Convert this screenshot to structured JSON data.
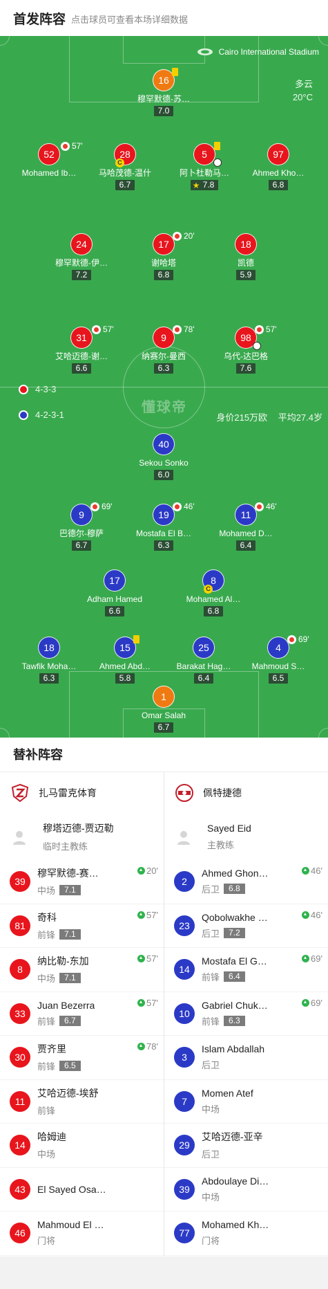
{
  "header": {
    "title": "首发阵容",
    "subtitle": "点击球员可查看本场详细数据"
  },
  "pitch": {
    "stadium": "Cairo International Stadium",
    "weather_desc": "多云",
    "weather_temp": "20°C",
    "watermark": "懂球帝",
    "home_formation": "4-3-3",
    "away_formation": "4-2-3-1",
    "value": "身价215万欧",
    "avg_age": "平均27.4岁"
  },
  "home_lineup": [
    {
      "num": "16",
      "name": "穆罕默德-苏…",
      "rating": "7.0",
      "color": "orange"
    },
    {
      "num": "52",
      "name": "Mohamed Ib…",
      "rating": "",
      "color": "red",
      "sub": "57'"
    },
    {
      "num": "28",
      "name": "马哈茂德-温什",
      "rating": "6.7",
      "color": "red"
    },
    {
      "num": "5",
      "name": "阿卜杜勒马…",
      "rating": "7.8",
      "color": "red"
    },
    {
      "num": "97",
      "name": "Ahmed Kho…",
      "rating": "6.8",
      "color": "red"
    },
    {
      "num": "24",
      "name": "穆罕默德-伊…",
      "rating": "7.2",
      "color": "red"
    },
    {
      "num": "17",
      "name": "谢哈塔",
      "rating": "6.8",
      "color": "red",
      "sub": "20'"
    },
    {
      "num": "18",
      "name": "凯德",
      "rating": "5.9",
      "color": "red"
    },
    {
      "num": "31",
      "name": "艾哈迈德-谢…",
      "rating": "6.6",
      "color": "red",
      "sub": "57'"
    },
    {
      "num": "9",
      "name": "纳赛尔-曼西",
      "rating": "6.3",
      "color": "red",
      "sub": "78'"
    },
    {
      "num": "98",
      "name": "乌代-达巴格",
      "rating": "7.6",
      "color": "red",
      "sub": "57'"
    }
  ],
  "away_lineup": [
    {
      "num": "40",
      "name": "Sekou Sonko",
      "rating": "6.0",
      "color": "blue"
    },
    {
      "num": "9",
      "name": "巴德尔-穆萨",
      "rating": "6.7",
      "color": "blue",
      "sub": "69'"
    },
    {
      "num": "19",
      "name": "Mostafa El B…",
      "rating": "6.3",
      "color": "blue",
      "sub": "46'"
    },
    {
      "num": "11",
      "name": "Mohamed D…",
      "rating": "6.4",
      "color": "blue",
      "sub": "46'"
    },
    {
      "num": "17",
      "name": "Adham Hamed",
      "rating": "6.6",
      "color": "blue"
    },
    {
      "num": "8",
      "name": "Mohamed Al…",
      "rating": "6.8",
      "color": "blue"
    },
    {
      "num": "18",
      "name": "Tawfik Moha…",
      "rating": "6.3",
      "color": "blue"
    },
    {
      "num": "15",
      "name": "Ahmed Abd…",
      "rating": "5.8",
      "color": "blue"
    },
    {
      "num": "25",
      "name": "Barakat Hag…",
      "rating": "6.4",
      "color": "blue"
    },
    {
      "num": "4",
      "name": "Mahmoud S…",
      "rating": "6.5",
      "color": "blue",
      "sub": "69'"
    },
    {
      "num": "1",
      "name": "Omar Salah",
      "rating": "6.7",
      "color": "orange"
    }
  ],
  "bench": {
    "title": "替补阵容",
    "home": {
      "team": "扎马雷克体育",
      "coach": "穆塔迈德-贾迈勒",
      "coach_role": "临时主教练",
      "subs": [
        {
          "num": "39",
          "name": "穆罕默德-赛…",
          "pos": "中场",
          "rating": "7.1",
          "in": "20'"
        },
        {
          "num": "81",
          "name": "奇科",
          "pos": "前锋",
          "rating": "7.1",
          "in": "57'"
        },
        {
          "num": "8",
          "name": "纳比勒-东加",
          "pos": "中场",
          "rating": "7.1",
          "in": "57'"
        },
        {
          "num": "33",
          "name": "Juan Bezerra",
          "pos": "前锋",
          "rating": "6.7",
          "in": "57'"
        },
        {
          "num": "30",
          "name": "贾齐里",
          "pos": "前锋",
          "rating": "6.5",
          "in": "78'"
        },
        {
          "num": "11",
          "name": "艾哈迈德-埃舒",
          "pos": "前锋",
          "rating": "",
          "in": ""
        },
        {
          "num": "14",
          "name": "哈姆迪",
          "pos": "中场",
          "rating": "",
          "in": ""
        },
        {
          "num": "43",
          "name": "El Sayed Osa…",
          "pos": "",
          "rating": "",
          "in": ""
        },
        {
          "num": "46",
          "name": "Mahmoud El …",
          "pos": "门将",
          "rating": "",
          "in": ""
        }
      ]
    },
    "away": {
      "team": "佩特捷德",
      "coach": "Sayed Eid",
      "coach_role": "主教练",
      "subs": [
        {
          "num": "2",
          "name": "Ahmed Ghon…",
          "pos": "后卫",
          "rating": "6.8",
          "in": "46'"
        },
        {
          "num": "23",
          "name": "Qobolwakhe …",
          "pos": "后卫",
          "rating": "7.2",
          "in": "46'"
        },
        {
          "num": "14",
          "name": "Mostafa El G…",
          "pos": "前锋",
          "rating": "6.4",
          "in": "69'"
        },
        {
          "num": "10",
          "name": "Gabriel Chuk…",
          "pos": "前锋",
          "rating": "6.3",
          "in": "69'"
        },
        {
          "num": "3",
          "name": "Islam Abdallah",
          "pos": "后卫",
          "rating": "",
          "in": ""
        },
        {
          "num": "7",
          "name": "Momen Atef",
          "pos": "中场",
          "rating": "",
          "in": ""
        },
        {
          "num": "29",
          "name": "艾哈迈德-亚辛",
          "pos": "后卫",
          "rating": "",
          "in": ""
        },
        {
          "num": "39",
          "name": "Abdoulaye Di…",
          "pos": "中场",
          "rating": "",
          "in": ""
        },
        {
          "num": "77",
          "name": "Mohamed Kh…",
          "pos": "门将",
          "rating": "",
          "in": ""
        }
      ]
    }
  }
}
